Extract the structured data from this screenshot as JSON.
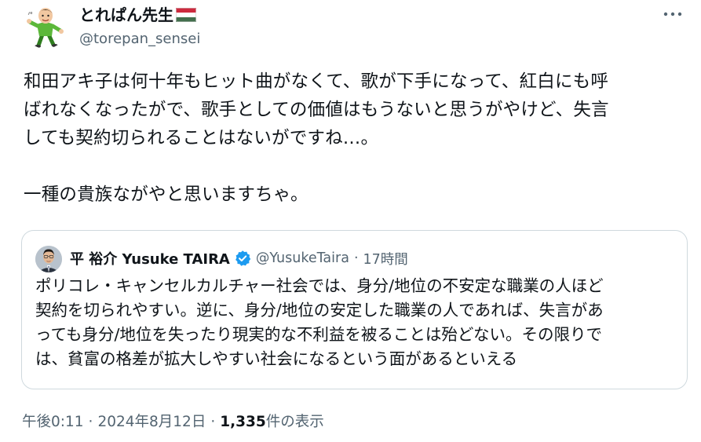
{
  "author": {
    "display_name": "とれぱん先生",
    "flag_icon": "hungary-flag-icon",
    "handle": "@torepan_sensei"
  },
  "tweet": {
    "text": "和田アキ子は何十年もヒット曲がなくて、歌が下手になって、紅白にも呼\nばれなくなったがで、歌手としての価値はもうないと思うがやけど、失言\nしても契約切られることはないがですね…。\n\n一種の貴族ながやと思いますちゃ。"
  },
  "quote": {
    "display_name": "平 裕介 Yusuke TAIRA",
    "verified_icon": "verified-badge-icon",
    "handle": "@YusukeTaira",
    "dot": "·",
    "time": "17時間",
    "text": "ポリコレ・キャンセルカルチャー社会では、身分/地位の不安定な職業の人ほど\n契約を切られやすい。逆に、身分/地位の安定した職業の人であれば、失言があ\nっても身分/地位を失ったり現実的な不利益を被ることは殆どない。その限りで\nは、貧富の格差が拡大しやすい社会になるという面があるといえる"
  },
  "meta": {
    "time": "午後0:11",
    "sep1": "·",
    "date": "2024年8月12日",
    "sep2": "·",
    "views_count": "1,335",
    "views_label": " 件の表示"
  },
  "colors": {
    "text_primary": "#0f1419",
    "text_secondary": "#536471",
    "border": "#cfd9de",
    "verified_blue": "#1d9bf0"
  }
}
